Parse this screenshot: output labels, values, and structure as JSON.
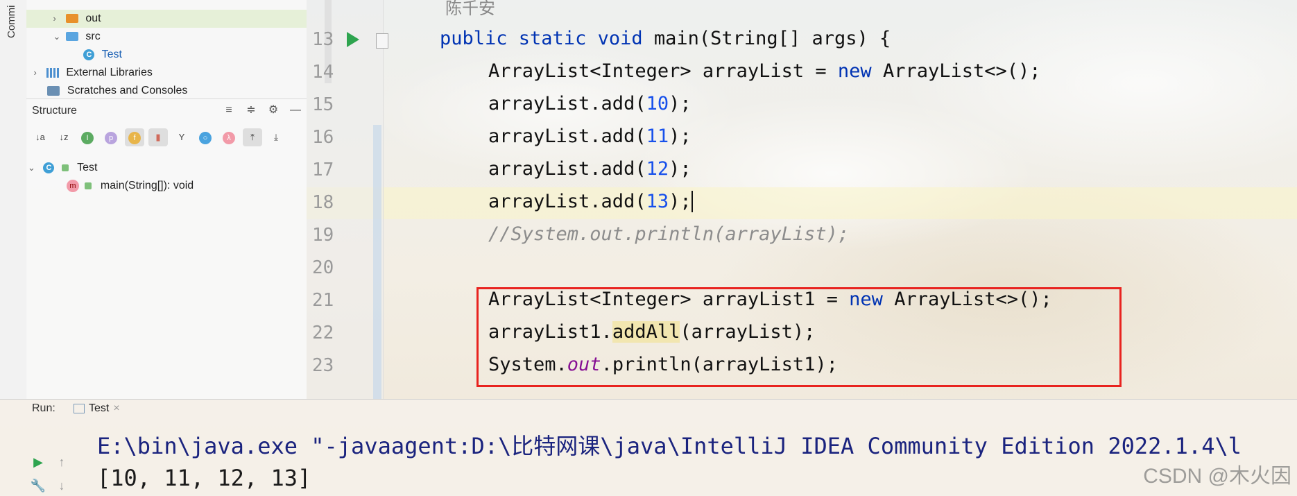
{
  "left_strip": {
    "commit_label": "Commi"
  },
  "project_tree": [
    {
      "label": "out",
      "kind": "folder",
      "color": "#e8912b",
      "selected": true
    },
    {
      "label": "src",
      "kind": "folder",
      "color": "#5aa5e0",
      "selected": false
    },
    {
      "label": "Test",
      "kind": "class",
      "selected": false
    },
    {
      "label": "External Libraries",
      "kind": "library",
      "selected": false
    },
    {
      "label": "Scratches and Consoles",
      "kind": "scratch",
      "selected": false
    }
  ],
  "structure": {
    "title": "Structure",
    "tree": [
      {
        "label": "Test"
      },
      {
        "label": "main(String[]): void"
      }
    ],
    "toolbar_icons": [
      "sort-az-icon",
      "sort-za-icon",
      "inherited-icon",
      "properties-icon",
      "fields-icon",
      "non-public-icon",
      "anonymous-icon",
      "circle-icon",
      "lambda-icon",
      "expand-icon",
      "collapse-icon"
    ]
  },
  "editor": {
    "author_line": "陈千安",
    "lines": [
      {
        "num": "13",
        "text": "public static void main(String[] args) {"
      },
      {
        "num": "14",
        "text": "ArrayList<Integer> arrayList = new ArrayList<>();"
      },
      {
        "num": "15",
        "text": "arrayList.add(10);"
      },
      {
        "num": "16",
        "text": "arrayList.add(11);"
      },
      {
        "num": "17",
        "text": "arrayList.add(12);"
      },
      {
        "num": "18",
        "text": "arrayList.add(13);"
      },
      {
        "num": "19",
        "text": "//System.out.println(arrayList);"
      },
      {
        "num": "20",
        "text": ""
      },
      {
        "num": "21",
        "text": "ArrayList<Integer> arrayList1 = new ArrayList<>();"
      },
      {
        "num": "22",
        "text": "arrayList1.addAll(arrayList);"
      },
      {
        "num": "23",
        "text": "System.out.println(arrayList1);"
      }
    ]
  },
  "run": {
    "label": "Run:",
    "tab": "Test",
    "command": "E:\\bin\\java.exe \"-javaagent:D:\\比特网课\\java\\IntelliJ IDEA Community Edition 2022.1.4\\l",
    "output": "[10, 11, 12, 13]"
  },
  "watermark": "CSDN @木火因"
}
